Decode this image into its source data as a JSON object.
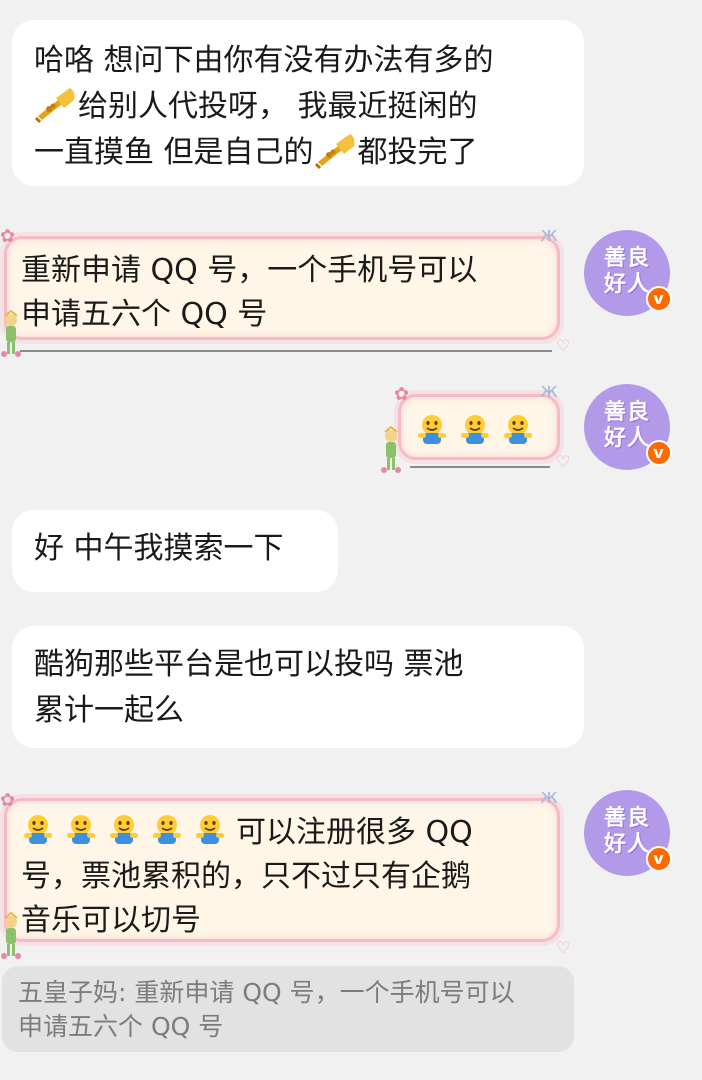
{
  "messages": {
    "m1": {
      "line1": "哈咯 想问下由你有没有办法有多的",
      "line2": "给别人代投呀， 我最近挺闲的",
      "line3a": "一直摸鱼 但是自己的",
      "line3b": "都投完了"
    },
    "m2": {
      "line1": "重新申请 QQ 号，一个手机号可以",
      "line2": "申请五六个 QQ 号"
    },
    "m4": {
      "line1": "好 中午我摸索一下"
    },
    "m5": {
      "line1": "酷狗那些平台是也可以投吗  票池",
      "line2": "累计一起么"
    },
    "m6": {
      "line1": "可以注册很多 QQ",
      "line2": "号，票池累积的，只不过只有企鹅",
      "line3": "音乐可以切号"
    }
  },
  "avatar": {
    "text1": "善良",
    "text2": "好人",
    "badge": "v",
    "bg_color": "#b39ae8",
    "badge_color": "#ff6a00"
  },
  "quote": {
    "line1": "五皇子妈: 重新申请 QQ 号，一个手机号可以",
    "line2": "申请五六个 QQ 号"
  },
  "icons": {
    "trumpet": "trumpet-emoji",
    "hugging": "hugging-emoji"
  }
}
